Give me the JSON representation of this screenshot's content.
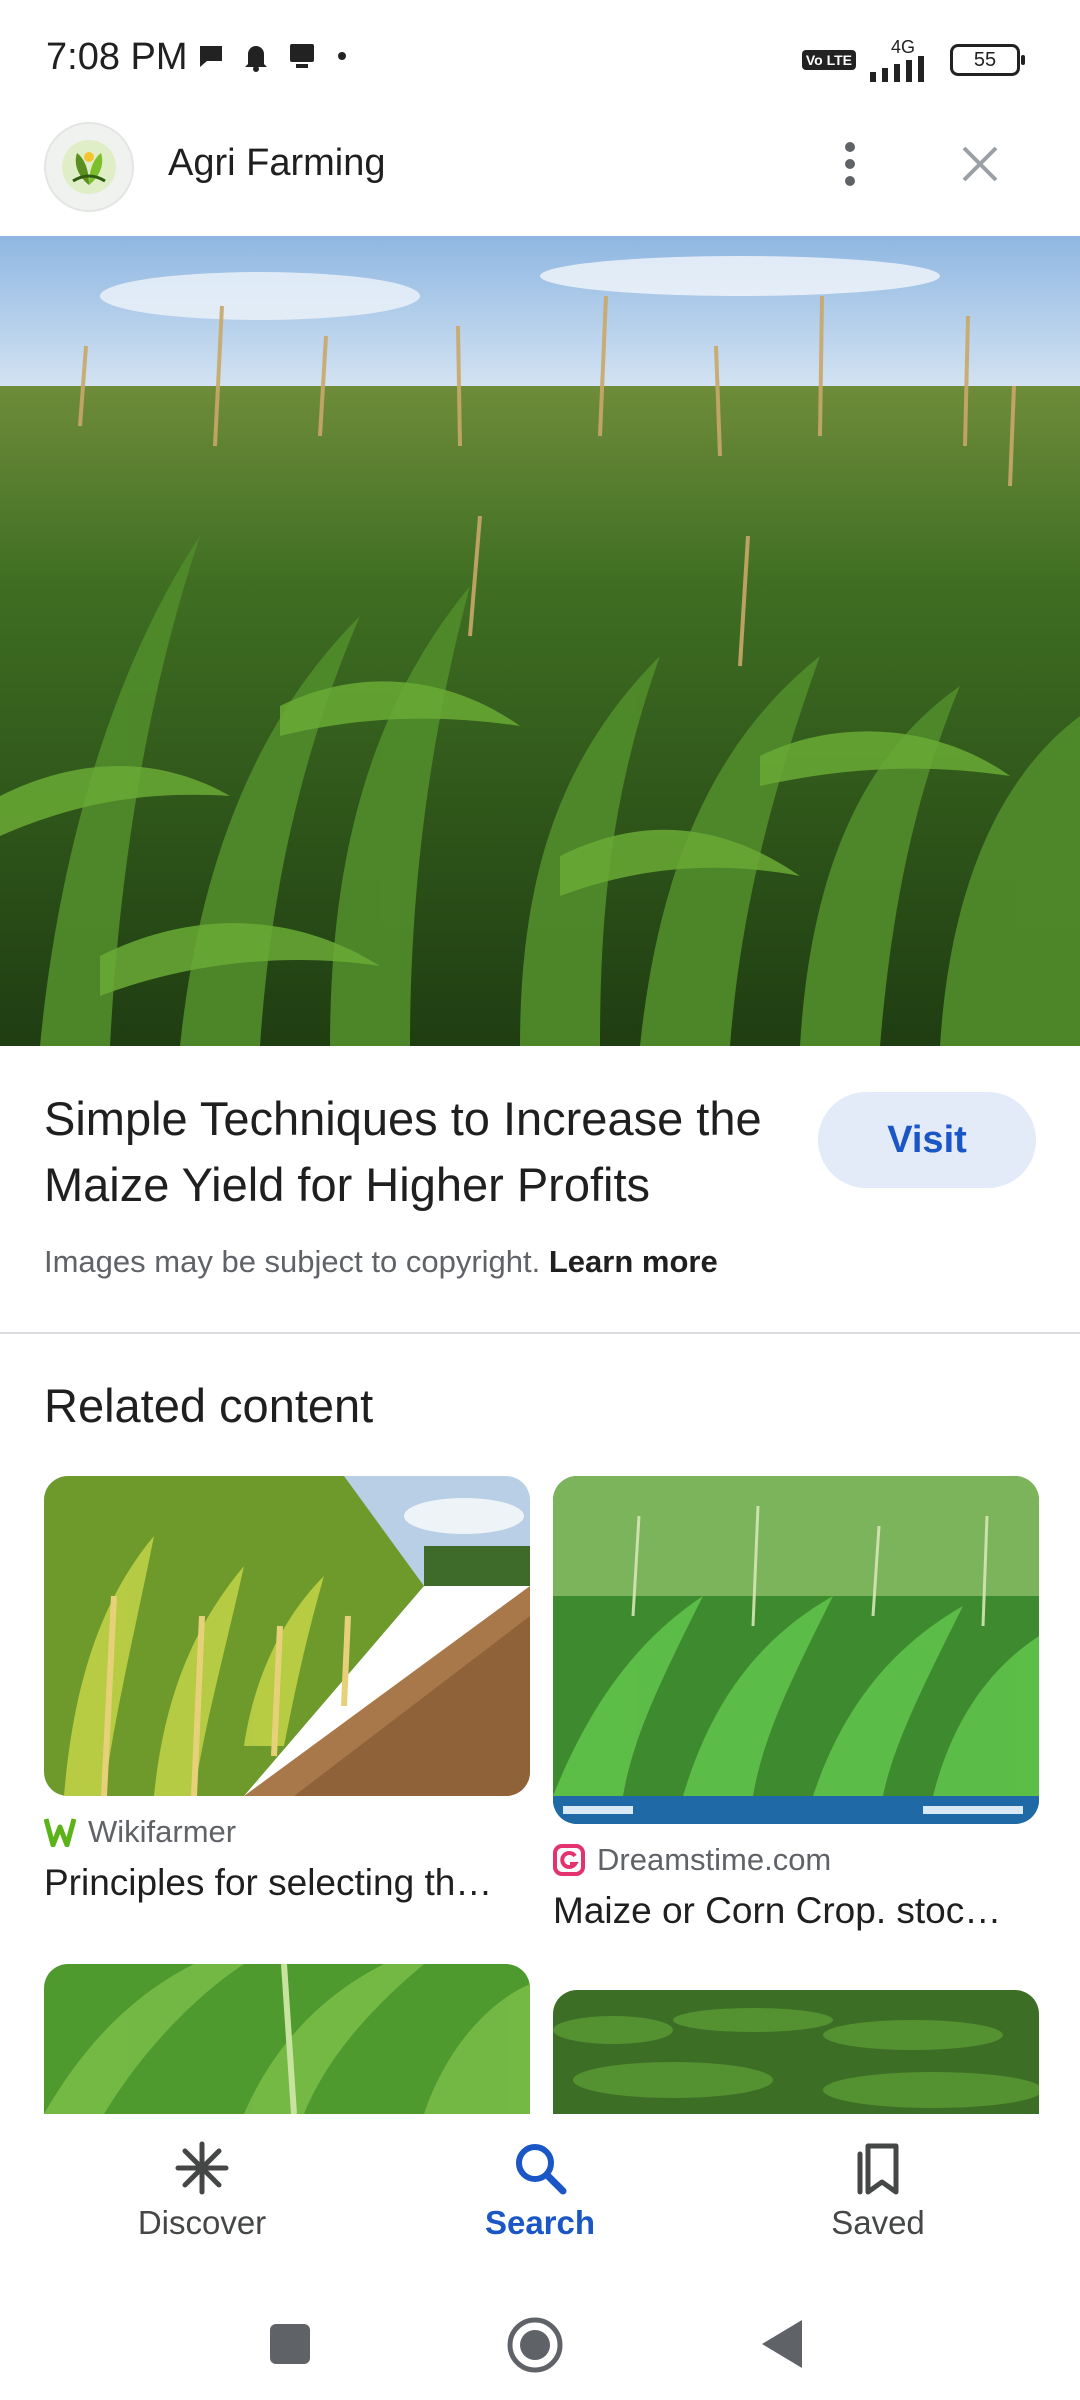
{
  "status_bar": {
    "time": "7:08 PM",
    "network": "4G",
    "volte": "Vo LTE",
    "battery": "55"
  },
  "header": {
    "site_name": "Agri Farming"
  },
  "article": {
    "title": "Simple Techniques to Increase the Maize Yield for Higher Profits",
    "visit_label": "Visit",
    "copyright_text": "Images may be subject to copyright.",
    "learn_more": "Learn more"
  },
  "related": {
    "heading": "Related content",
    "items": [
      {
        "source": "Wikifarmer",
        "title": "Principles for selecting th…"
      },
      {
        "source": "Dreamstime.com",
        "title": "Maize or Corn Crop. stoc…"
      }
    ]
  },
  "bottom_nav": {
    "items": [
      {
        "label": "Discover",
        "icon": "asterisk-icon"
      },
      {
        "label": "Search",
        "icon": "search-icon",
        "active": true
      },
      {
        "label": "Saved",
        "icon": "bookmark-icon"
      }
    ]
  },
  "colors": {
    "accent": "#1a56c5",
    "visit_bg": "#e3ebf9"
  }
}
